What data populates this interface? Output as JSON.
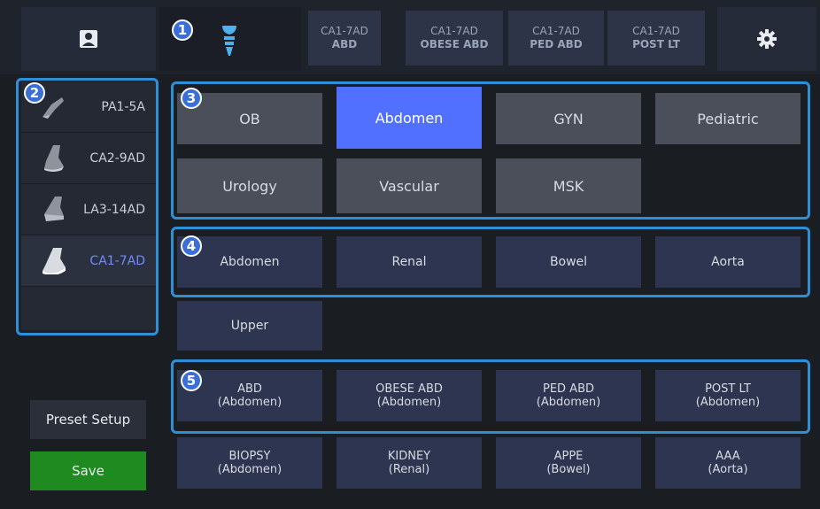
{
  "badges": {
    "topbar": "1",
    "probes": "2",
    "categories": "3",
    "sub_categories": "4",
    "presets": "5"
  },
  "mode_tabs": [
    {
      "line1": "CA1-7AD",
      "line2": "ABD"
    },
    {
      "line1": "CA1-7AD",
      "line2": "OBESE ABD"
    },
    {
      "line1": "CA1-7AD",
      "line2": "PED ABD"
    },
    {
      "line1": "CA1-7AD",
      "line2": "POST LT"
    }
  ],
  "probes": [
    {
      "label": "PA1-5A",
      "active": false
    },
    {
      "label": "CA2-9AD",
      "active": false
    },
    {
      "label": "LA3-14AD",
      "active": false
    },
    {
      "label": "CA1-7AD",
      "active": true
    }
  ],
  "categories": [
    {
      "label": "OB",
      "selected": false
    },
    {
      "label": "Abdomen",
      "selected": true
    },
    {
      "label": "GYN",
      "selected": false
    },
    {
      "label": "Pediatric",
      "selected": false
    },
    {
      "label": "Urology",
      "selected": false
    },
    {
      "label": "Vascular",
      "selected": false
    },
    {
      "label": "MSK",
      "selected": false
    }
  ],
  "sub_categories": [
    {
      "label": "Abdomen"
    },
    {
      "label": "Renal"
    },
    {
      "label": "Bowel"
    },
    {
      "label": "Aorta"
    },
    {
      "label": "Upper"
    }
  ],
  "presets": [
    {
      "name": "ABD",
      "group": "(Abdomen)"
    },
    {
      "name": "OBESE ABD",
      "group": "(Abdomen)"
    },
    {
      "name": "PED ABD",
      "group": "(Abdomen)"
    },
    {
      "name": "POST LT",
      "group": "(Abdomen)"
    },
    {
      "name": "BIOPSY",
      "group": "(Abdomen)"
    },
    {
      "name": "KIDNEY",
      "group": "(Renal)"
    },
    {
      "name": "APPE",
      "group": "(Bowel)"
    },
    {
      "name": "AAA",
      "group": "(Aorta)"
    }
  ],
  "sidebar": {
    "preset_setup_label": "Preset Setup",
    "save_label": "Save"
  },
  "icons": {
    "topbar_left": "user-profile-icon",
    "topbar_probe": "probe-icon",
    "topbar_right": "gear-icon"
  },
  "colors": {
    "accent": "#5270ff",
    "highlight_border": "#2e8fd6",
    "save_green": "#1f8a1f",
    "badge": "#3b6fd8"
  }
}
